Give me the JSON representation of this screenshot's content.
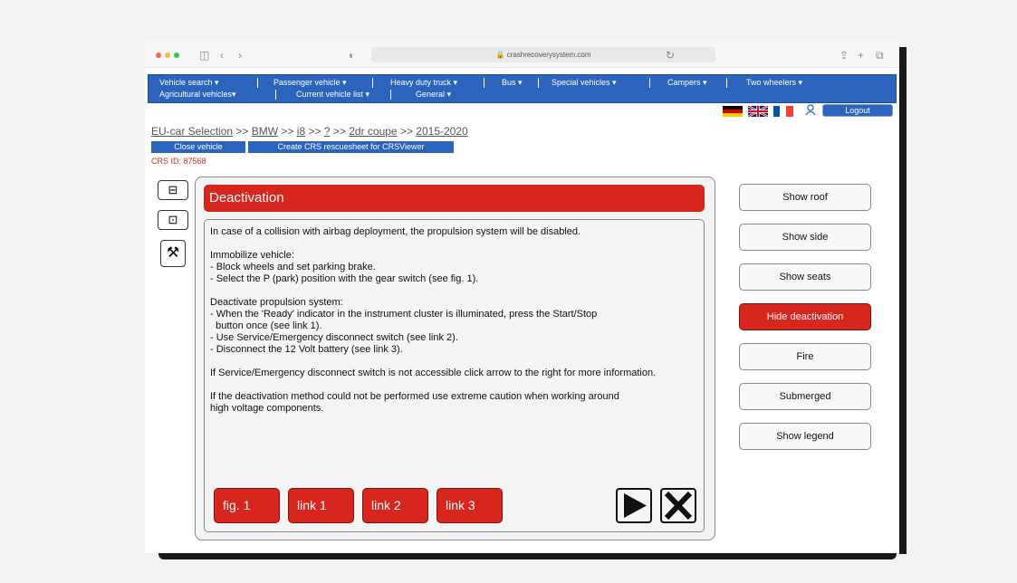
{
  "browser": {
    "url": "crashrecoverysystem.com"
  },
  "nav": {
    "row1": [
      "Vehicle search",
      "Passenger vehicle",
      "Heavy duty truck",
      "Bus",
      "Special vehicles",
      "Campers",
      "Two wheelers"
    ],
    "row2": [
      "Agricultural vehicles",
      "Current vehicle list",
      "General"
    ],
    "logout": "Logout"
  },
  "breadcrumb": {
    "root": "EU-car Selection",
    "sep": ">>",
    "items": [
      "BMW",
      "i8",
      "?",
      "2dr coupe",
      "2015-2020"
    ]
  },
  "actions": {
    "close": "Close vehicle",
    "create": "Create CRS rescuesheet for CRSViewer"
  },
  "crs_id": "CRS ID: 87568",
  "panel": {
    "title": "Deactivation",
    "lines": [
      "In case of a collision with airbag deployment, the propulsion system will be disabled.",
      "",
      "Immobilize vehicle:",
      "- Block wheels and set parking brake.",
      "- Select the P (park) position with the gear switch (see fig. 1).",
      "",
      "Deactivate propulsion system:",
      "- When the 'Ready' indicator in the instrument cluster is illuminated, press the Start/Stop",
      "  button once (see link 1).",
      "- Use Service/Emergency disconnect switch (see link 2).",
      "- Disconnect the 12 Volt battery (see link 3).",
      "",
      "If Service/Emergency disconnect switch is not accessible click arrow to the right for more information.",
      "",
      "If the deactivation method could not be performed use extreme caution when working around",
      "high voltage components."
    ],
    "buttons": [
      "fig. 1",
      "link 1",
      "link 2",
      "link 3"
    ]
  },
  "right_buttons": [
    "Show roof",
    "Show side",
    "Show seats",
    "Hide deactivation",
    "Fire",
    "Submerged",
    "Show legend"
  ],
  "colors": {
    "accent_red": "#d7261e",
    "nav_blue": "#2b63bd"
  }
}
